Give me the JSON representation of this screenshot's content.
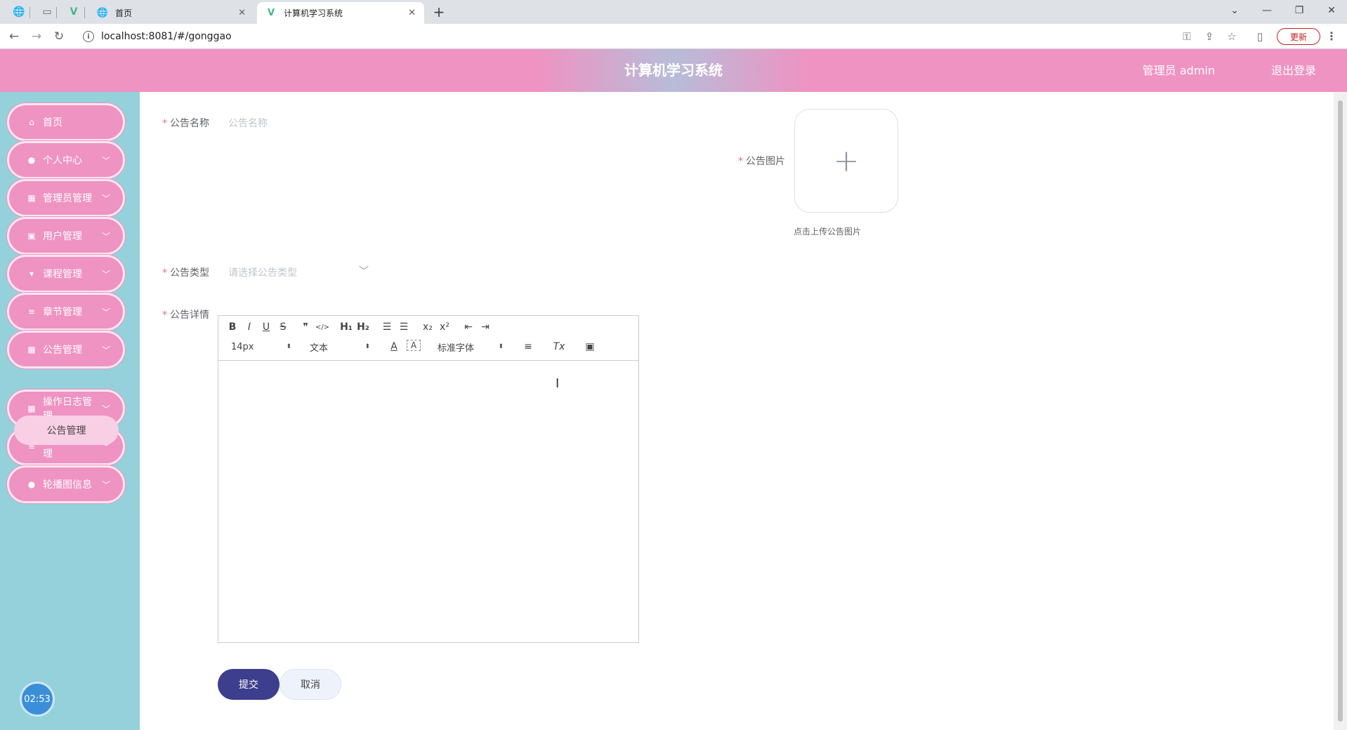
{
  "browser": {
    "tabs": [
      {
        "label": "首页",
        "active": false
      },
      {
        "label": "计算机学习系统",
        "active": true
      }
    ],
    "new_tab": "+",
    "url": "localhost:8081/#/gonggao",
    "update_label": "更新",
    "icons": {
      "back": "←",
      "forward": "→",
      "reload": "↻",
      "info": "i",
      "key": "⚿",
      "share": "⇪",
      "star": "☆",
      "sidepanel": "▯",
      "profile": "●",
      "menu": "⋮",
      "minimize": "—",
      "restore": "❐",
      "close": "✕",
      "tabs_list": "⌄"
    }
  },
  "header": {
    "title": "计算机学习系统",
    "user": "管理员 admin",
    "logout": "退出登录"
  },
  "sidebar": {
    "items": [
      {
        "label": "首页",
        "icon": "home-icon",
        "glyph": "⌂",
        "has_arrow": false
      },
      {
        "label": "个人中心",
        "icon": "user-icon",
        "glyph": "●",
        "has_arrow": true
      },
      {
        "label": "管理员管理",
        "icon": "grid-icon",
        "glyph": "▦",
        "has_arrow": true
      },
      {
        "label": "用户管理",
        "icon": "clipboard-icon",
        "glyph": "▣",
        "has_arrow": true
      },
      {
        "label": "课程管理",
        "icon": "brush-icon",
        "glyph": "▾",
        "has_arrow": true
      },
      {
        "label": "章节管理",
        "icon": "list-icon",
        "glyph": "≡",
        "has_arrow": true
      },
      {
        "label": "公告管理",
        "icon": "apps-icon",
        "glyph": "▦",
        "has_arrow": true
      },
      {
        "label": "操作日志管理",
        "icon": "grid-icon",
        "glyph": "▦",
        "has_arrow": true
      },
      {
        "label": "基础数据管理",
        "icon": "list-icon",
        "glyph": "≡",
        "has_arrow": true
      },
      {
        "label": "轮播图信息",
        "icon": "location-icon",
        "glyph": "●",
        "has_arrow": true
      }
    ],
    "arrow_glyph": "﹀",
    "submenu": {
      "label": "公告管理"
    },
    "clock": "02:53"
  },
  "form": {
    "name_label": "公告名称",
    "name_placeholder": "公告名称",
    "image_label": "公告图片",
    "upload_plus": "+",
    "upload_hint": "点击上传公告图片",
    "type_label": "公告类型",
    "type_placeholder": "请选择公告类型",
    "type_chevron": "﹀",
    "detail_label": "公告详情",
    "required_mark": "*",
    "submit": "提交",
    "cancel": "取消"
  },
  "editor": {
    "toolbar_row1": [
      {
        "name": "bold",
        "glyph": "B"
      },
      {
        "name": "italic",
        "glyph": "I"
      },
      {
        "name": "underline",
        "glyph": "U"
      },
      {
        "name": "strike",
        "glyph": "S"
      },
      {
        "name": "blockquote",
        "glyph": "❞"
      },
      {
        "name": "code-block",
        "glyph": "</>"
      },
      {
        "name": "header1",
        "glyph": "H₁"
      },
      {
        "name": "header2",
        "glyph": "H₂"
      },
      {
        "name": "ordered-list",
        "glyph": "☰"
      },
      {
        "name": "bullet-list",
        "glyph": "☰"
      },
      {
        "name": "subscript",
        "glyph": "x₂"
      },
      {
        "name": "superscript",
        "glyph": "x²"
      },
      {
        "name": "outdent",
        "glyph": "⇤"
      },
      {
        "name": "indent",
        "glyph": "⇥"
      }
    ],
    "size_select": "14px",
    "header_select": "文本",
    "font_color": "A",
    "background": "A",
    "font_select": "标准字体",
    "align": "≡",
    "clean": "Tx",
    "image": "▣",
    "select_arrow": "⬍",
    "cursor": "I"
  },
  "colors": {
    "header_pink": "#ee93c2",
    "sidebar_teal": "#94d1da",
    "submit_navy": "#3e3e8e",
    "required_red": "#f56c6c"
  }
}
